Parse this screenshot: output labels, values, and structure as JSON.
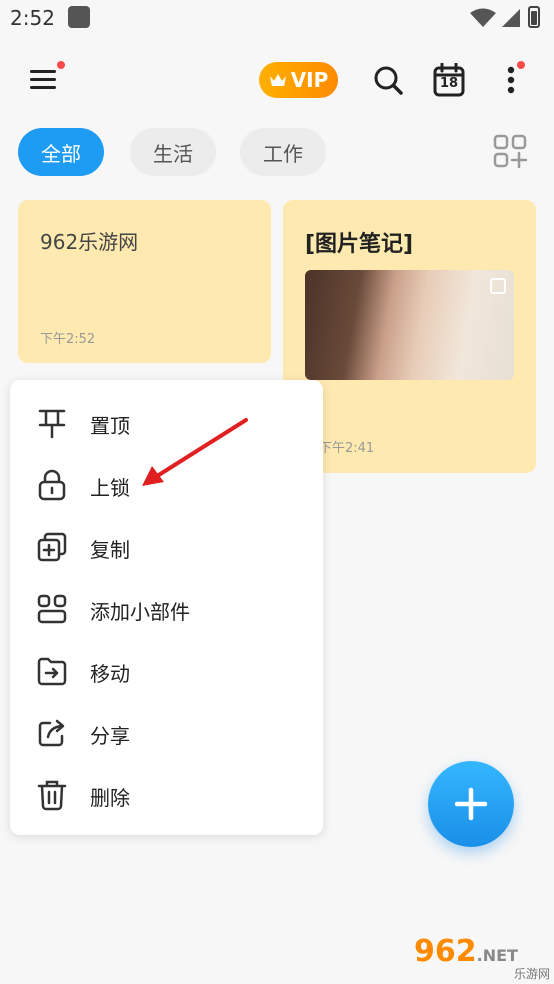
{
  "status": {
    "time": "2:52"
  },
  "header": {
    "vip_label": "VIP"
  },
  "tabs": [
    {
      "label": "全部",
      "selected": true
    },
    {
      "label": "生活",
      "selected": false
    },
    {
      "label": "工作",
      "selected": false
    }
  ],
  "calendar_day": "18",
  "notes": [
    {
      "title": "962乐游网",
      "time": "下午2:52"
    },
    {
      "title": "[图片笔记]",
      "time": "下午2:41"
    }
  ],
  "context_menu": {
    "items": [
      {
        "label": "置顶",
        "icon": "pin-icon"
      },
      {
        "label": "上锁",
        "icon": "lock-icon"
      },
      {
        "label": "复制",
        "icon": "copy-icon"
      },
      {
        "label": "添加小部件",
        "icon": "widget-icon"
      },
      {
        "label": "移动",
        "icon": "move-folder-icon"
      },
      {
        "label": "分享",
        "icon": "share-icon"
      },
      {
        "label": "删除",
        "icon": "trash-icon"
      }
    ]
  },
  "watermark": {
    "logo": "962",
    "net": ".NET",
    "sub": "乐游网"
  },
  "colors": {
    "accent": "#1e9bf2",
    "note_bg": "#feeab0",
    "vip": "#ff9a00",
    "badge": "#ff4b4b",
    "arrow": "#e02020"
  }
}
